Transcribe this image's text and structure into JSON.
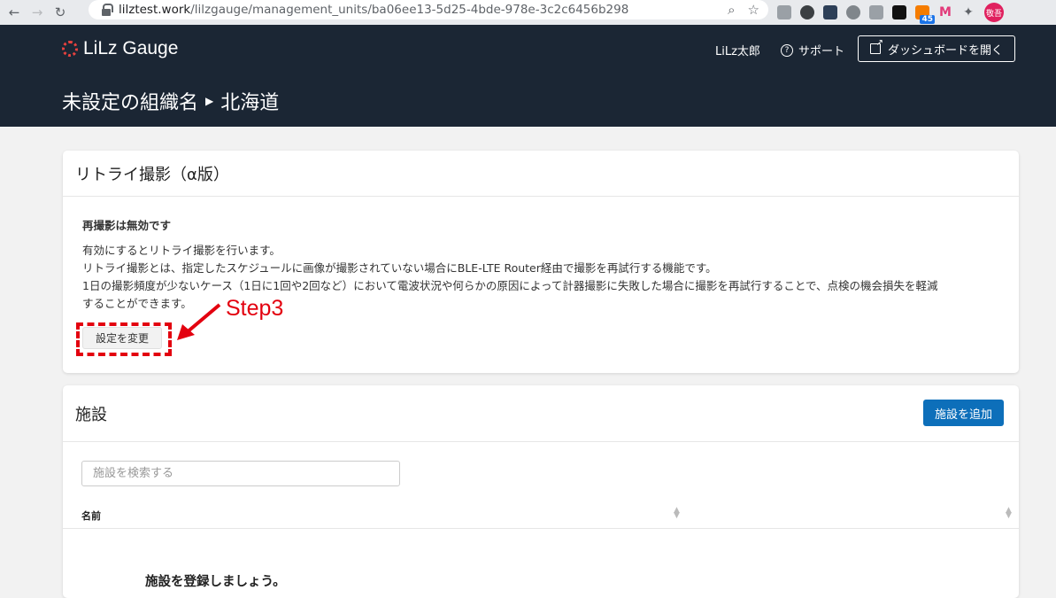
{
  "browser": {
    "back_icon": "←",
    "forward_icon": "→",
    "reload_icon": "↻",
    "url_host": "lilztest.work",
    "url_path": "/lilzgauge/management_units/ba06ee13-5d25-4bde-978e-3c2c6456b298",
    "zoom_icon": "⌕",
    "star_icon": "☆",
    "badge_count": "45",
    "profile_label": "敬吾"
  },
  "header": {
    "logo_text": "LiLz Gauge",
    "user_name": "LiLz太郎",
    "support_label": "サポート",
    "dashboard_button": "ダッシュボードを開く",
    "breadcrumb": {
      "org": "未設定の組織名",
      "unit": "北海道"
    }
  },
  "retry_card": {
    "title": "リトライ撮影（α版）",
    "status": "再撮影は無効です",
    "lines": [
      "有効にするとリトライ撮影を行います。",
      "リトライ撮影とは、指定したスケジュールに画像が撮影されていない場合にBLE-LTE Router経由で撮影を再試行する機能です。",
      "1日の撮影頻度が少ないケース（1日に1回や2回など）において電波状況や何らかの原因によって計器撮影に失敗した場合に撮影を再試行することで、点検の機会損失を軽減",
      "することができます。"
    ],
    "change_button": "設定を変更"
  },
  "facility_card": {
    "title": "施設",
    "add_button": "施設を追加",
    "search_placeholder": "施設を検索する",
    "column_name": "名前",
    "empty_message": "施設を登録しましょう。"
  },
  "annotation": {
    "label": "Step3",
    "color": "#e3000f"
  }
}
